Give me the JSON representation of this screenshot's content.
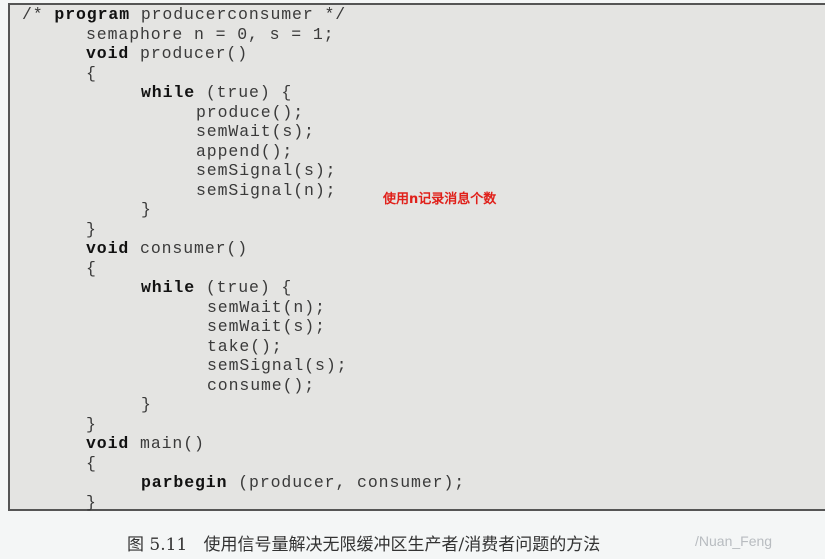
{
  "code_lines": [
    {
      "kw": "",
      "pre": "/* ",
      "kw2": "program",
      "text": " producerconsumer */"
    },
    {
      "text": "semaphore n = 0, s = 1;"
    },
    {
      "kw": "void",
      "text": " producer()"
    },
    {
      "text": "{"
    },
    {
      "kw": "while",
      "text": " (true) {"
    },
    {
      "text": "produce();"
    },
    {
      "text": "semWait(s);"
    },
    {
      "text": "append();"
    },
    {
      "text": "semSignal(s);"
    },
    {
      "text": "semSignal(n);"
    },
    {
      "text": "}"
    },
    {
      "text": "}"
    },
    {
      "kw": "void",
      "text": " consumer()"
    },
    {
      "text": "{"
    },
    {
      "kw": "while",
      "text": " (true) {"
    },
    {
      "text": "semWait(n);"
    },
    {
      "text": "semWait(s);"
    },
    {
      "text": "take();"
    },
    {
      "text": "semSignal(s);"
    },
    {
      "text": "consume();"
    },
    {
      "text": "}"
    },
    {
      "text": "}"
    },
    {
      "kw": "void",
      "text": " main()"
    },
    {
      "text": "{"
    },
    {
      "kw": "parbegin",
      "text": " (producer, consumer);"
    },
    {
      "text": "}"
    }
  ],
  "annotation": "使用n记录消息个数",
  "annotation_color": "#e0201a",
  "caption": "图 5.11   使用信号量解决无限缓冲区生产者/消费者问题的方法",
  "watermark": "/Nuan_Feng"
}
